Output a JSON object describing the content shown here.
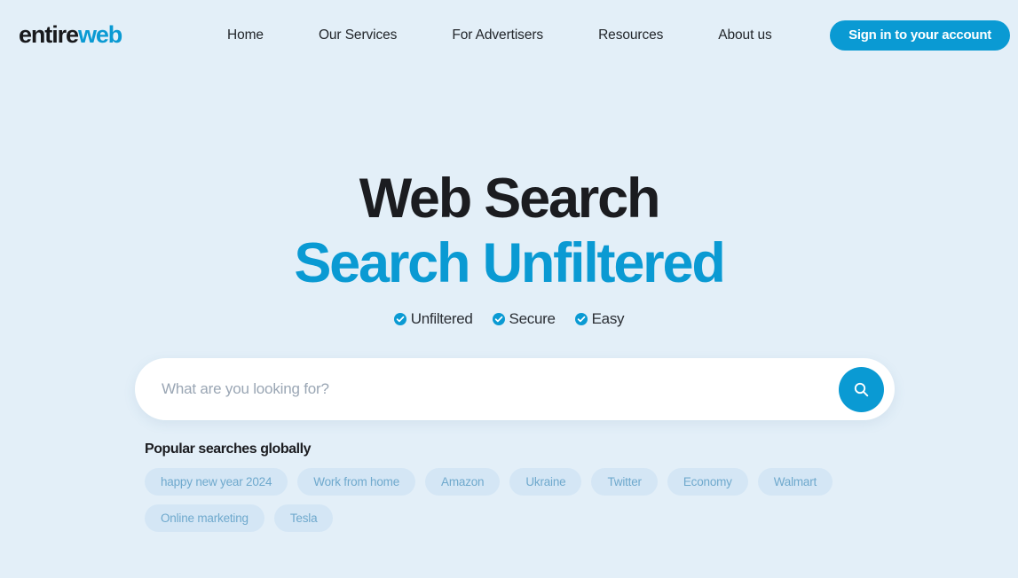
{
  "theme": {
    "background": "#e3eff8",
    "accent": "#0a9ad3",
    "dark_text": "#1b1c20",
    "tag_bg": "#d4e6f5",
    "tag_text": "#6fa9cd",
    "search_bg": "#ffffff"
  },
  "header": {
    "logo": {
      "part1": "entire",
      "part2": "web"
    },
    "nav": [
      {
        "label": "Home"
      },
      {
        "label": "Our Services"
      },
      {
        "label": "For Advertisers"
      },
      {
        "label": "Resources"
      },
      {
        "label": "About us"
      }
    ],
    "signin_label": "Sign in to your account"
  },
  "hero": {
    "headline_line1": "Web Search",
    "headline_line2": "Search Unfiltered",
    "features": [
      {
        "label": "Unfiltered",
        "icon": "check-circle-icon"
      },
      {
        "label": "Secure",
        "icon": "check-circle-icon"
      },
      {
        "label": "Easy",
        "icon": "check-circle-icon"
      }
    ]
  },
  "search": {
    "value": "",
    "placeholder": "What are you looking for?",
    "button_icon": "search-icon"
  },
  "popular": {
    "title": "Popular searches globally",
    "tags": [
      {
        "label": "happy new year 2024"
      },
      {
        "label": "Work from home"
      },
      {
        "label": "Amazon"
      },
      {
        "label": "Ukraine"
      },
      {
        "label": "Twitter"
      },
      {
        "label": "Economy"
      },
      {
        "label": "Walmart"
      },
      {
        "label": "Online marketing"
      },
      {
        "label": "Tesla"
      }
    ]
  }
}
